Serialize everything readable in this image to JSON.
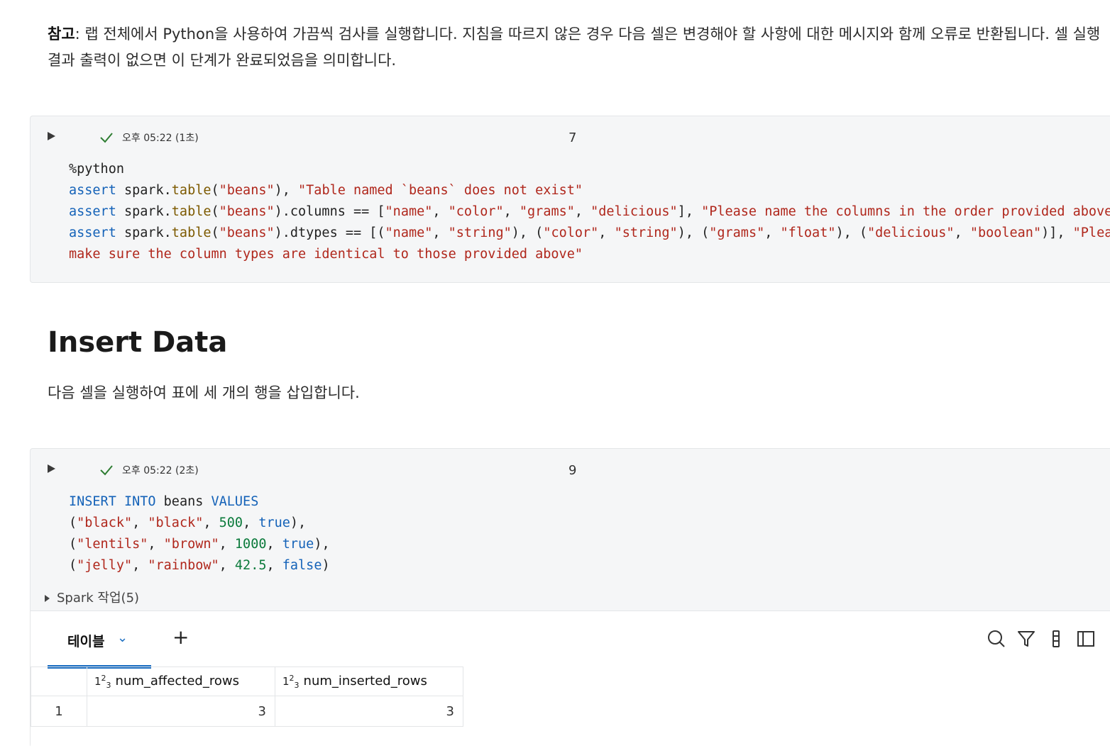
{
  "note": {
    "bold": "참고",
    "text": ": 랩 전체에서 Python을 사용하여 가끔씩 검사를 실행합니다. 지침을 따르지 않은 경우 다음 셀은 변경해야 할 사항에 대한 메시지와 함께 오류로 반환됩니다. 셀 실행 결과 출력이 없으면 이 단계가 완료되었음을 의미합니다."
  },
  "cell1": {
    "timestamp": "오후 05:22 (1초)",
    "number": "7",
    "code_lines": [
      "%python",
      "assert spark.table(\"beans\"), \"Table named `beans` does not exist\"",
      "assert spark.table(\"beans\").columns == [\"name\", \"color\", \"grams\", \"delicious\"], \"Please name the columns in the order provided above\"",
      "assert spark.table(\"beans\").dtypes == [(\"name\", \"string\"), (\"color\", \"string\"), (\"grams\", \"float\"), (\"delicious\", \"boolean\")], \"Please",
      "make sure the column types are identical to those provided above\""
    ]
  },
  "section": {
    "heading": "Insert Data",
    "description": "다음 셀을 실행하여 표에 세 개의 행을 삽입합니다."
  },
  "cell2": {
    "timestamp": "오후 05:22 (2초)",
    "number": "9",
    "code_lines": [
      "INSERT INTO beans VALUES",
      "(\"black\", \"black\", 500, true),",
      "(\"lentils\", \"brown\", 1000, true),",
      "(\"jelly\", \"rainbow\", 42.5, false)"
    ],
    "spark_jobs": "Spark 작업(5)",
    "result_tab": "테이블",
    "add_tab": "+",
    "columns": [
      "num_affected_rows",
      "num_inserted_rows"
    ],
    "rows": [
      {
        "index": "1",
        "values": [
          "3",
          "3"
        ]
      }
    ]
  },
  "colors": {
    "accent": "#1b6ec2",
    "check": "#2e7d32",
    "string": "#b0271c",
    "keyword": "#1462b8",
    "number": "#0b7a3b"
  },
  "icons": [
    "play-icon",
    "check-icon",
    "search-icon",
    "filter-icon",
    "column-settings-icon",
    "sidebar-panel-icon"
  ]
}
